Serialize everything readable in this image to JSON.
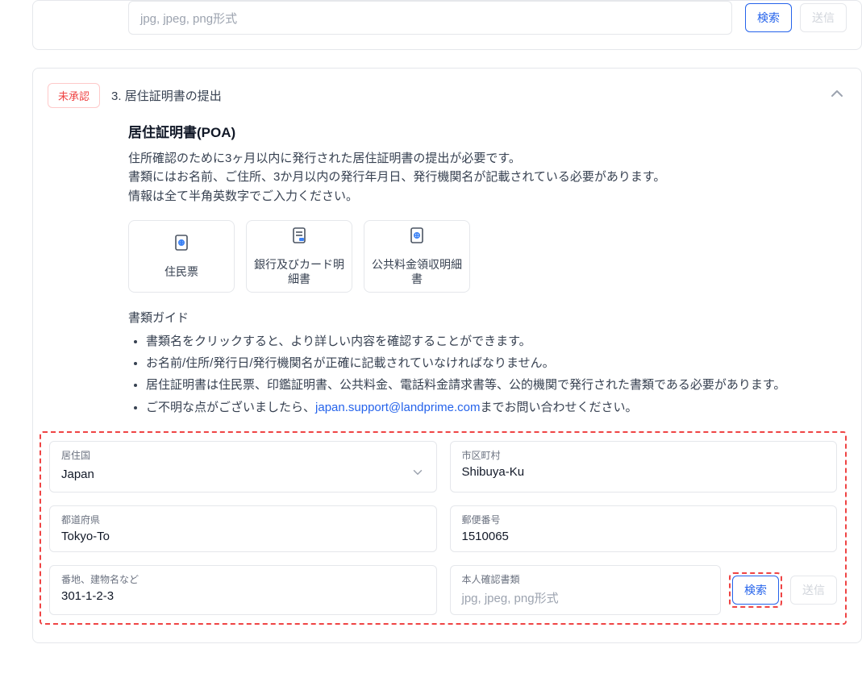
{
  "top_panel": {
    "upload_placeholder": "jpg, jpeg, png形式",
    "search_btn": "検索",
    "submit_btn": "送信"
  },
  "section": {
    "status_badge": "未承認",
    "num_title": "3. 居住証明書の提出",
    "heading": "居住証明書(POA)",
    "desc_line1": "住所確認のために3ヶ月以内に発行された居住証明書の提出が必要です。",
    "desc_line2": "書類にはお名前、ご住所、3か月以内の発行年月日、発行機関名が記載されている必要があります。",
    "desc_line3": "情報は全て半角英数字でご入力ください。",
    "doc_cards": {
      "c1": "住民票",
      "c2": "銀行及びカード明細書",
      "c3": "公共料金領収明細書"
    },
    "guide_title": "書類ガイド",
    "guide_items": {
      "g1": "書類名をクリックすると、より詳しい内容を確認することができます。",
      "g2": "お名前/住所/発行日/発行機関名が正確に記載されていなければなりません。",
      "g3": "居住証明書は住民票、印鑑証明書、公共料金、電話料金請求書等、公的機関で発行された書類である必要があります。",
      "g4_pre": "ご不明な点がございましたら、",
      "g4_mail": "japan.support@landprime.com",
      "g4_post": "までお問い合わせください。"
    },
    "form": {
      "country_label": "居住国",
      "country_value": "Japan",
      "city_label": "市区町村",
      "city_value": "Shibuya-Ku",
      "prefecture_label": "都道府県",
      "prefecture_value": "Tokyo-To",
      "postal_label": "郵便番号",
      "postal_value": "1510065",
      "address_label": "番地、建物名など",
      "address_value": "301-1-2-3",
      "iddoc_label": "本人確認書類",
      "iddoc_placeholder": "jpg, jpeg, png形式",
      "search_btn": "検索",
      "submit_btn": "送信"
    }
  }
}
